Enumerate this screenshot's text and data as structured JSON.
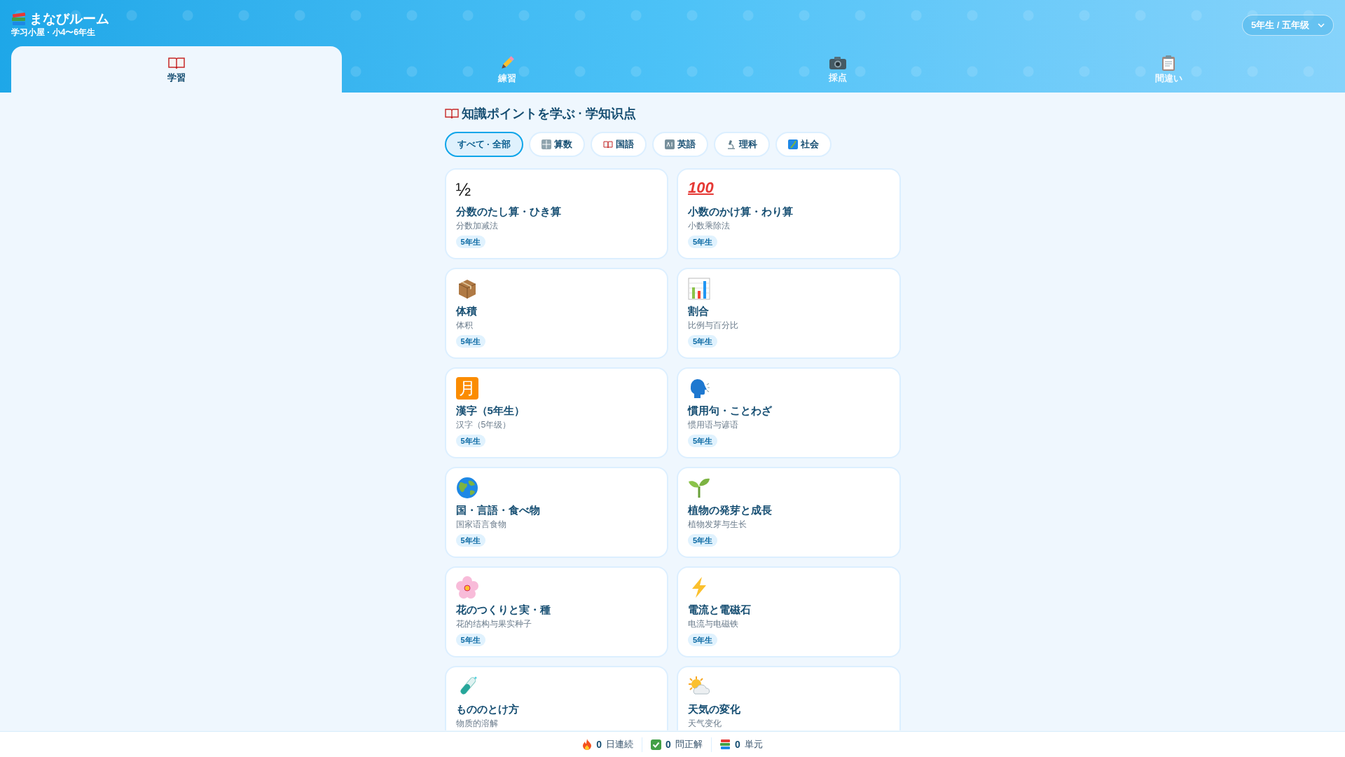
{
  "app": {
    "title": "まなびルーム",
    "subtitle": "学习小屋 · 小4〜6年生"
  },
  "grade_selector": {
    "value": "5年生 / 五年级"
  },
  "tabs": [
    {
      "label": "学習",
      "selected": true
    },
    {
      "label": "練習",
      "selected": false
    },
    {
      "label": "採点",
      "selected": false
    },
    {
      "label": "間違い",
      "selected": false
    }
  ],
  "section_title": "知識ポイントを学ぶ · 学知识点",
  "filters": [
    {
      "label": "すべて · 全部",
      "selected": true
    },
    {
      "label": "算数",
      "selected": false
    },
    {
      "label": "国語",
      "selected": false
    },
    {
      "label": "英語",
      "selected": false
    },
    {
      "label": "理科",
      "selected": false
    },
    {
      "label": "社会",
      "selected": false
    }
  ],
  "cards": [
    {
      "symbol": "½",
      "title": "分数のたし算・ひき算",
      "subtitle": "分数加减法",
      "badge": "5年生"
    },
    {
      "symbol": "100",
      "title": "小数のかけ算・わり算",
      "subtitle": "小数乘除法",
      "badge": "5年生"
    },
    {
      "title": "体積",
      "subtitle": "体积",
      "badge": "5年生"
    },
    {
      "title": "割合",
      "subtitle": "比例与百分比",
      "badge": "5年生"
    },
    {
      "symbol": "月",
      "title": "漢字（5年生）",
      "subtitle": "汉字（5年级）",
      "badge": "5年生"
    },
    {
      "title": "慣用句・ことわざ",
      "subtitle": "惯用语与谚语",
      "badge": "5年生"
    },
    {
      "title": "国・言語・食べ物",
      "subtitle": "国家语言食物",
      "badge": "5年生"
    },
    {
      "title": "植物の発芽と成長",
      "subtitle": "植物发芽与生长",
      "badge": "5年生"
    },
    {
      "title": "花のつくりと実・種",
      "subtitle": "花的结构与果实种子",
      "badge": "5年生"
    },
    {
      "title": "電流と電磁石",
      "subtitle": "电流与电磁铁",
      "badge": "5年生"
    },
    {
      "title": "もののとけ方",
      "subtitle": "物质的溶解"
    },
    {
      "title": "天気の変化",
      "subtitle": "天气变化"
    }
  ],
  "status_bar": [
    {
      "value": "0",
      "label": "日連続"
    },
    {
      "value": "0",
      "label": "問正解"
    },
    {
      "value": "0",
      "label": "単元"
    }
  ]
}
